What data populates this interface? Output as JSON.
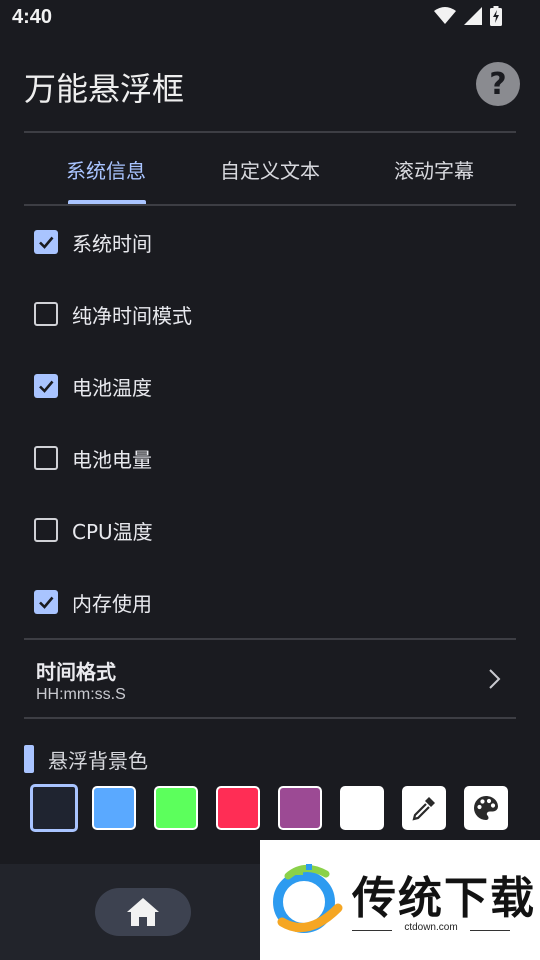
{
  "status_bar": {
    "time": "4:40"
  },
  "header": {
    "title": "万能悬浮框"
  },
  "tabs": [
    {
      "label": "系统信息",
      "active": true
    },
    {
      "label": "自定义文本",
      "active": false
    },
    {
      "label": "滚动字幕",
      "active": false
    }
  ],
  "options": [
    {
      "label": "系统时间",
      "checked": true
    },
    {
      "label": "纯净时间模式",
      "checked": false
    },
    {
      "label": "电池温度",
      "checked": true
    },
    {
      "label": "电池电量",
      "checked": false
    },
    {
      "label": "CPU温度",
      "checked": false
    },
    {
      "label": "内存使用",
      "checked": true
    }
  ],
  "time_format": {
    "title": "时间格式",
    "value": "HH:mm:ss.S"
  },
  "background_color": {
    "title": "悬浮背景色",
    "swatches": [
      {
        "color": "#1f2430",
        "selected": true
      },
      {
        "color": "#5aa9ff",
        "selected": false
      },
      {
        "color": "#5cff5c",
        "selected": false
      },
      {
        "color": "#ff2d55",
        "selected": false
      },
      {
        "color": "#9c4a94",
        "selected": false
      },
      {
        "color": "#ffffff",
        "selected": false
      }
    ],
    "tools": [
      "eyedropper-icon",
      "palette-icon"
    ]
  },
  "accent_color": "#a9c4ff",
  "watermark": {
    "brand": "传统下载",
    "url": "ctdown.com"
  }
}
